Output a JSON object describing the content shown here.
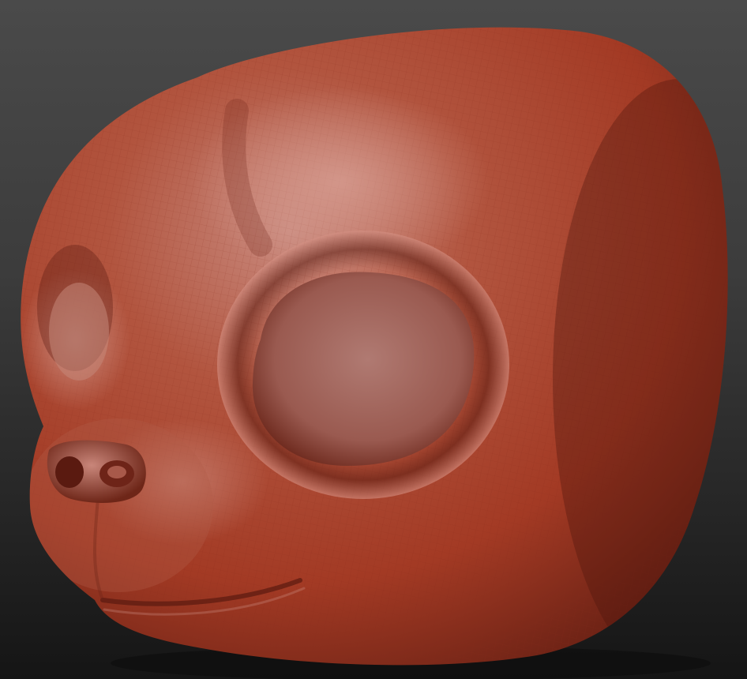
{
  "scene": {
    "subject": "sculpted-creature-head",
    "colors": {
      "background_top": "#4a4a4a",
      "background_bottom": "#151515",
      "clay_light": "#c98a7e",
      "clay_mid": "#a8402c",
      "clay_dark": "#5a1a10",
      "eye_socket": "#a86c64",
      "wire": "#8a2a1c"
    }
  }
}
